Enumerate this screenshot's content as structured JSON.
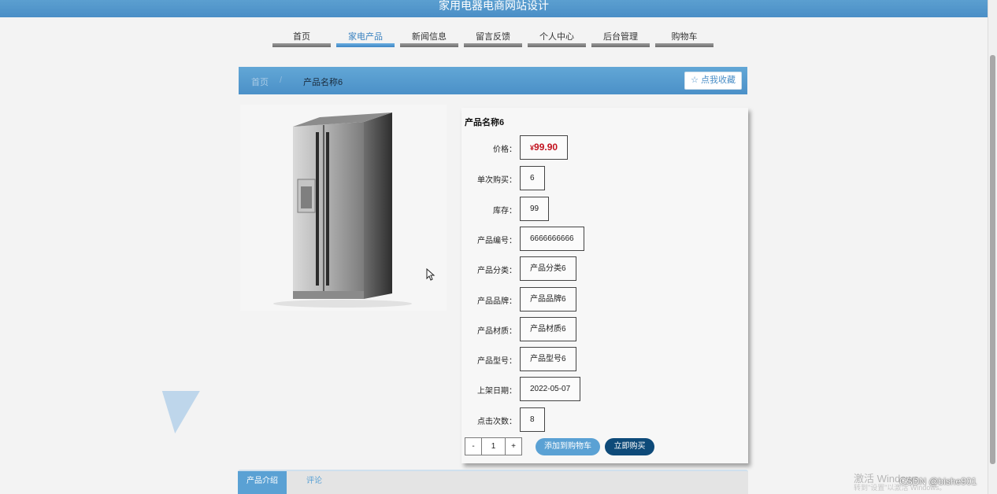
{
  "site": {
    "title": "家用电器电商网站设计"
  },
  "nav": {
    "items": [
      {
        "label": "首页"
      },
      {
        "label": "家电产品"
      },
      {
        "label": "新闻信息"
      },
      {
        "label": "留言反馈"
      },
      {
        "label": "个人中心"
      },
      {
        "label": "后台管理"
      },
      {
        "label": "购物车"
      }
    ],
    "active_index": 1
  },
  "breadcrumb": {
    "home": "首页",
    "separator": "/",
    "current": "产品名称6"
  },
  "favorite_button": {
    "icon": "star-outline-icon",
    "label": "点我收藏"
  },
  "product": {
    "name": "产品名称6",
    "image_icon": "refrigerator-image",
    "fields": [
      {
        "label": "价格：",
        "currency": "¥",
        "value": "99.90"
      },
      {
        "label": "单次购买：",
        "value": "6"
      },
      {
        "label": "库存：",
        "value": "99"
      },
      {
        "label": "产品编号：",
        "value": "6666666666"
      },
      {
        "label": "产品分类：",
        "value": "产品分类6"
      },
      {
        "label": "产品品牌：",
        "value": "产品品牌6"
      },
      {
        "label": "产品材质：",
        "value": "产品材质6"
      },
      {
        "label": "产品型号：",
        "value": "产品型号6"
      },
      {
        "label": "上架日期：",
        "value": "2022-05-07"
      },
      {
        "label": "点击次数：",
        "value": "8"
      }
    ]
  },
  "quantity": {
    "minus": "-",
    "value": "1",
    "plus": "+"
  },
  "actions": {
    "add_to_cart": "添加到购物车",
    "buy_now": "立即购买"
  },
  "tabs": [
    {
      "label": "产品介绍"
    },
    {
      "label": "评论"
    }
  ],
  "overlay": {
    "windows_watermark": "激活 Windows",
    "windows_watermark_sub": "转到\"设置\"以激活 Windows。",
    "csdn": "CSDN @bishe901"
  },
  "colors": {
    "primary": "#4a8ec6",
    "price": "#c2121e",
    "buy": "#0e4a79"
  }
}
